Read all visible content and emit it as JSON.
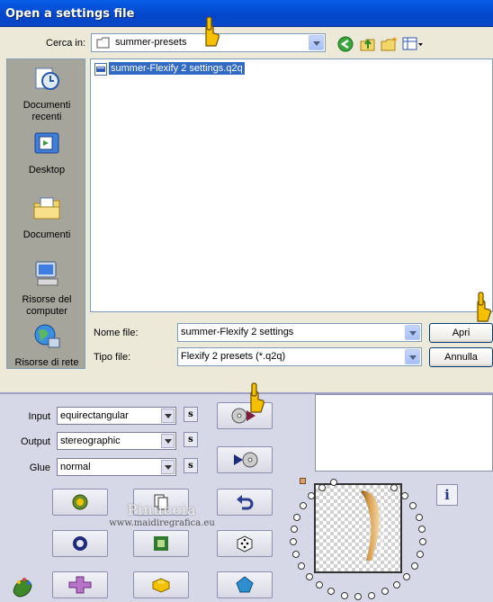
{
  "dialog": {
    "title": "Open a settings file",
    "look_in_label": "Cerca in:",
    "look_in_value": "summer-presets",
    "places": [
      {
        "label": "Documenti recenti",
        "icon": "recent-documents-icon"
      },
      {
        "label": "Desktop",
        "icon": "desktop-icon"
      },
      {
        "label": "Documenti",
        "icon": "documents-folder-icon"
      },
      {
        "label": "Risorse del computer",
        "icon": "my-computer-icon"
      },
      {
        "label": "Risorse di rete",
        "icon": "network-icon"
      }
    ],
    "files": [
      {
        "name": "summer-Flexify 2 settings.q2q",
        "selected": true
      }
    ],
    "filename_label": "Nome file:",
    "filename_value": "summer-Flexify 2 settings",
    "filetype_label": "Tipo file:",
    "filetype_value": "Flexify 2 presets (*.q2q)",
    "open_button": "Apri",
    "cancel_button": "Annulla"
  },
  "flexify": {
    "input_label": "Input",
    "input_value": "equirectangular",
    "output_label": "Output",
    "output_value": "stereographic",
    "glue_label": "Glue",
    "glue_value": "normal",
    "s_button": "s",
    "info_button": "i",
    "watermark_name": "Pinuccia",
    "watermark_url": "www.maidiregrafica.eu"
  },
  "colors": {
    "titlebar": "#0a5ee8",
    "dialog_bg": "#ece9d8",
    "panel_bg": "#d6d7e7",
    "selection": "#316ac5",
    "pointer_hand": "#f5c000"
  }
}
